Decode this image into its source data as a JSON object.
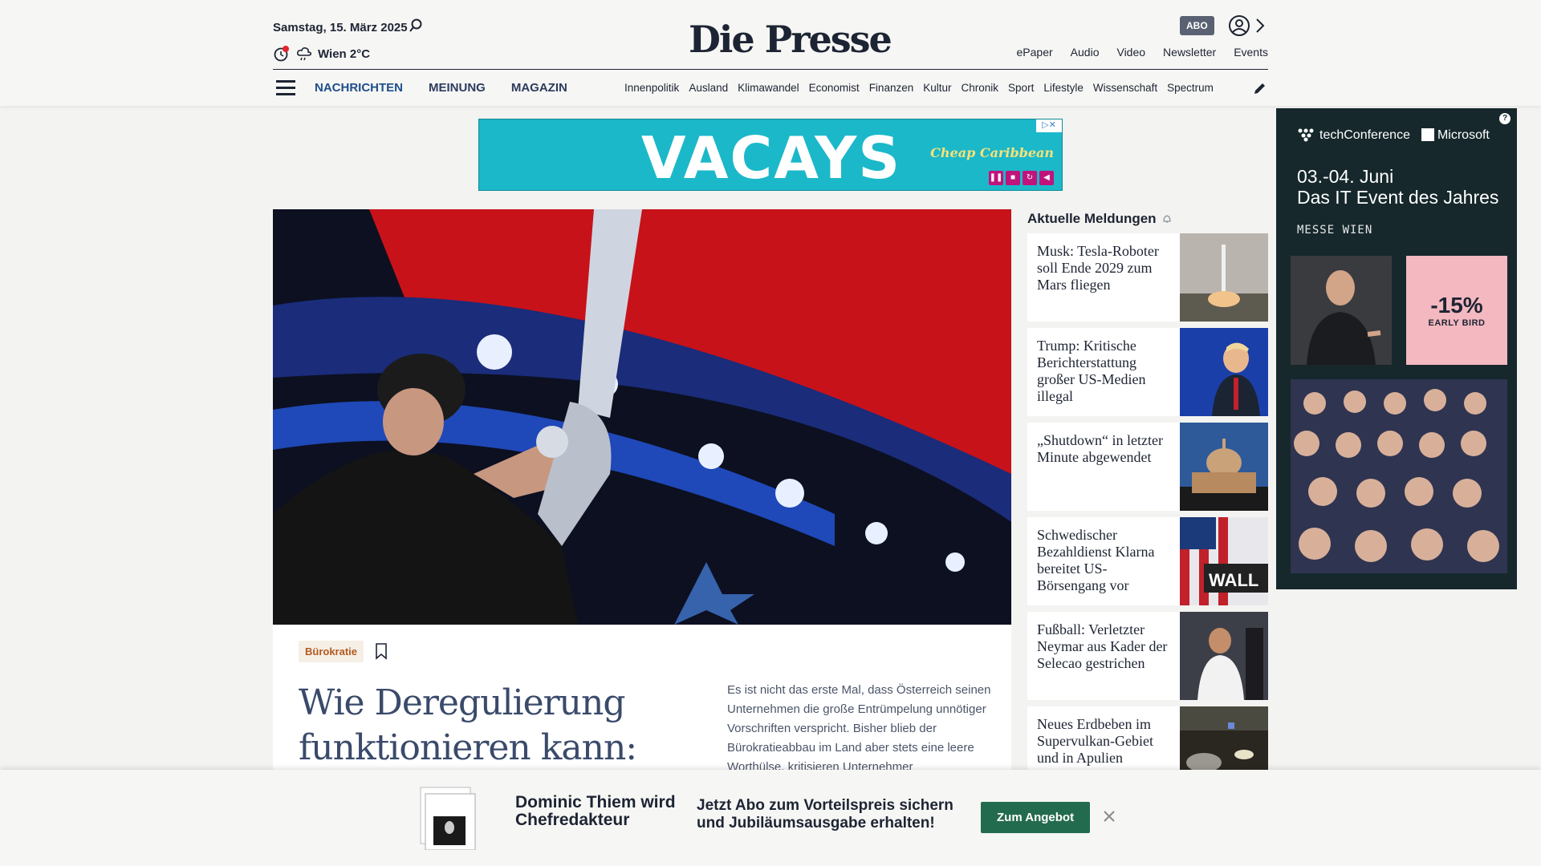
{
  "header": {
    "date": "Samstag, 15. März 2025",
    "weather": "Wien 2°C",
    "logo": "Die Presse",
    "abo_label": "ABO",
    "top_links": [
      "ePaper",
      "Audio",
      "Video",
      "Newsletter",
      "Events"
    ],
    "main_nav": [
      "NACHRICHTEN",
      "MEINUNG",
      "MAGAZIN"
    ],
    "sub_nav": [
      "Innenpolitik",
      "Ausland",
      "Klimawandel",
      "Economist",
      "Finanzen",
      "Kultur",
      "Chronik",
      "Sport",
      "Lifestyle",
      "Wissenschaft",
      "Spectrum"
    ]
  },
  "ad_banner": {
    "headline": "VACAYS",
    "brand": "Cheap Caribbean"
  },
  "article": {
    "tag": "Bürokratie",
    "headline": "Wie Deregulierung funktionieren kann:",
    "teaser": "Es ist nicht das erste Mal, dass Österreich seinen Unternehmen die große Entrümpelung unnötiger Vorschriften verspricht. Bisher blieb der Bürokratieabbau im Land aber stets eine leere Worthülse, kritisieren Unternehmer"
  },
  "news": {
    "heading": "Aktuelle Meldungen",
    "items": [
      {
        "title": "Musk: Tesla-Roboter soll Ende 2029 zum Mars fliegen",
        "thumb": "rocket-launch"
      },
      {
        "title": "Trump: Kritische Berichterstattung großer US-Medien illegal",
        "thumb": "trump-podium"
      },
      {
        "title": "„Shutdown“ in letzter Minute abgewendet",
        "thumb": "capitol"
      },
      {
        "title": "Schwedischer Bezahldienst Klarna bereitet US-Börsengang vor",
        "thumb": "wall-street"
      },
      {
        "title": "Fußball: Verletzter Neymar aus Kader der Selecao gestrichen",
        "thumb": "neymar"
      },
      {
        "title": "Neues Erdbeben im Supervulkan-Gebiet und in Apulien",
        "thumb": "street-night"
      }
    ]
  },
  "side_ad": {
    "brand1": "techConference",
    "brand2": "Microsoft",
    "dates": "03.-04. Juni",
    "tagline": "Das IT Event des Jahres",
    "venue": "MESSE WIEN",
    "discount": "-15%",
    "discount_label": "EARLY BIRD"
  },
  "bottom_banner": {
    "title": "Dominic Thiem wird Chefredakteur",
    "text": "Jetzt Abo zum Vorteilspreis sichern und Jubiläumsausgabe erhalten!",
    "cta": "Zum Angebot"
  }
}
